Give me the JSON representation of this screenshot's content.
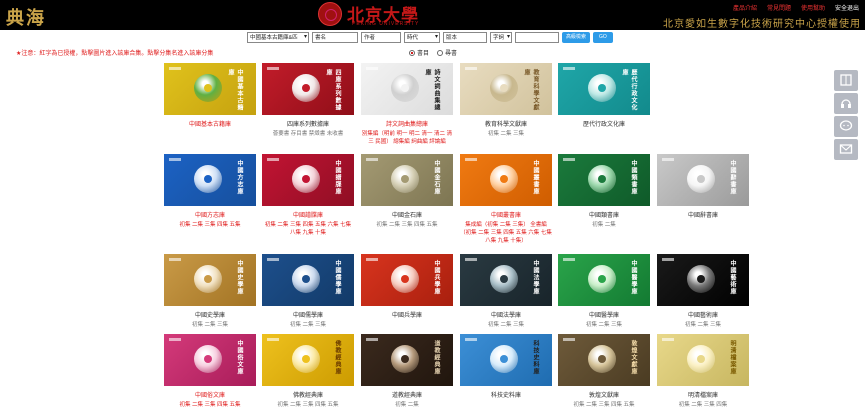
{
  "header": {
    "logo": "典海",
    "pku_name": "北京大學",
    "pku_sub": "PEKING UNIVERSITY",
    "links": [
      "產品介紹",
      "常見問題",
      "使用幫助",
      "安全退出"
    ],
    "authorized": "北京愛如生數字化技術研究中心授權使用"
  },
  "search": {
    "scope": "中國基本古籍庫&匹",
    "field1_placeholder": "書名",
    "field2_placeholder": "作者",
    "field3_select": "時代",
    "field4_placeholder": "版本",
    "field5_select": "字詞",
    "field5_value": "",
    "secondary_button": "高級檢索",
    "go_button": "GO"
  },
  "mode": {
    "option1": "書目",
    "option2": "尋書"
  },
  "notice": "★注意：紅字為已授權，點擊圖片進入該庫合集。點擊分集名進入該庫分集",
  "colors": {
    "accent_red": "#e02020",
    "header_bg": "#000000",
    "gold": "#c9a349",
    "button_blue": "#2d9be8"
  },
  "cards": [
    {
      "title": "中國基本古籍庫",
      "red": true,
      "cover": "中國基本古籍庫",
      "sub": ""
    },
    {
      "title": "四庫系列數據庫",
      "red": false,
      "cover": "四庫系列數據庫",
      "sub": "薈要書 存目書 禁燬書 未收書"
    },
    {
      "title": "詩文詞曲集總庫",
      "red": true,
      "cover": "詩文詞曲集總庫",
      "sub": "別集編（明前 明一 明二 清一 清二 清三 民國） 總集編 詞曲編 評論編"
    },
    {
      "title": "教育科學文獻庫",
      "red": false,
      "cover": "教育科學文獻庫",
      "sub": "初集 二集 三集"
    },
    {
      "title": "歷代行政文化庫",
      "red": false,
      "cover": "歷代行政文化庫",
      "sub": ""
    },
    {
      "title": "中國方志庫",
      "red": true,
      "cover": "中國方志庫",
      "sub": "初集 二集 三集 四集 五集"
    },
    {
      "title": "中國譜牒庫",
      "red": true,
      "cover": "中國譜牒庫",
      "sub": "初集 二集 三集 四集 五集 六集 七集 八集 九集 十集"
    },
    {
      "title": "中國金石庫",
      "red": false,
      "cover": "中國金石庫",
      "sub": "初集 二集 三集 四集 五集"
    },
    {
      "title": "中國叢書庫",
      "red": true,
      "cover": "中國叢書庫",
      "sub": "集成編（初集 二集 三集） 全書編（初集 二集 三集 四集 五集 六集 七集 八集 九集 十集）"
    },
    {
      "title": "中國類書庫",
      "red": false,
      "cover": "中國類書庫",
      "sub": "初集 二集"
    },
    {
      "title": "中國辭書庫",
      "red": false,
      "cover": "中國辭書庫",
      "sub": ""
    },
    {
      "title": "中國史學庫",
      "red": false,
      "cover": "中國史學庫",
      "sub": "初集 二集 三集"
    },
    {
      "title": "中國儒學庫",
      "red": false,
      "cover": "中國儒學庫",
      "sub": "初集 二集 三集"
    },
    {
      "title": "中國兵學庫",
      "red": false,
      "cover": "中國兵學庫",
      "sub": ""
    },
    {
      "title": "中國法學庫",
      "red": false,
      "cover": "中國法學庫",
      "sub": "初集 二集 三集"
    },
    {
      "title": "中國醫學庫",
      "red": false,
      "cover": "中國醫學庫",
      "sub": "初集 二集 三集"
    },
    {
      "title": "中國藝術庫",
      "red": false,
      "cover": "中國藝術庫",
      "sub": "初集 二集 三集"
    },
    {
      "title": "中國俗文庫",
      "red": true,
      "cover": "中國俗文庫",
      "sub": "初集 二集 三集 四集 五集"
    },
    {
      "title": "佛教經典庫",
      "red": false,
      "cover": "佛教經典庫",
      "sub": "初集 二集 三集 四集 五集"
    },
    {
      "title": "道教經典庫",
      "red": false,
      "cover": "道教經典庫",
      "sub": "初集 二集"
    },
    {
      "title": "科技史料庫",
      "red": false,
      "cover": "科技史料庫",
      "sub": ""
    },
    {
      "title": "敦煌文獻庫",
      "red": false,
      "cover": "敦煌文獻庫",
      "sub": "初集 二集 三集 四集 五集"
    },
    {
      "title": "明清檔案庫",
      "red": false,
      "cover": "明清檔案庫",
      "sub": "初集 二集 三集 四集"
    }
  ],
  "sidebar_icons": [
    "book-icon",
    "headset-icon",
    "chat-icon",
    "mail-icon"
  ]
}
